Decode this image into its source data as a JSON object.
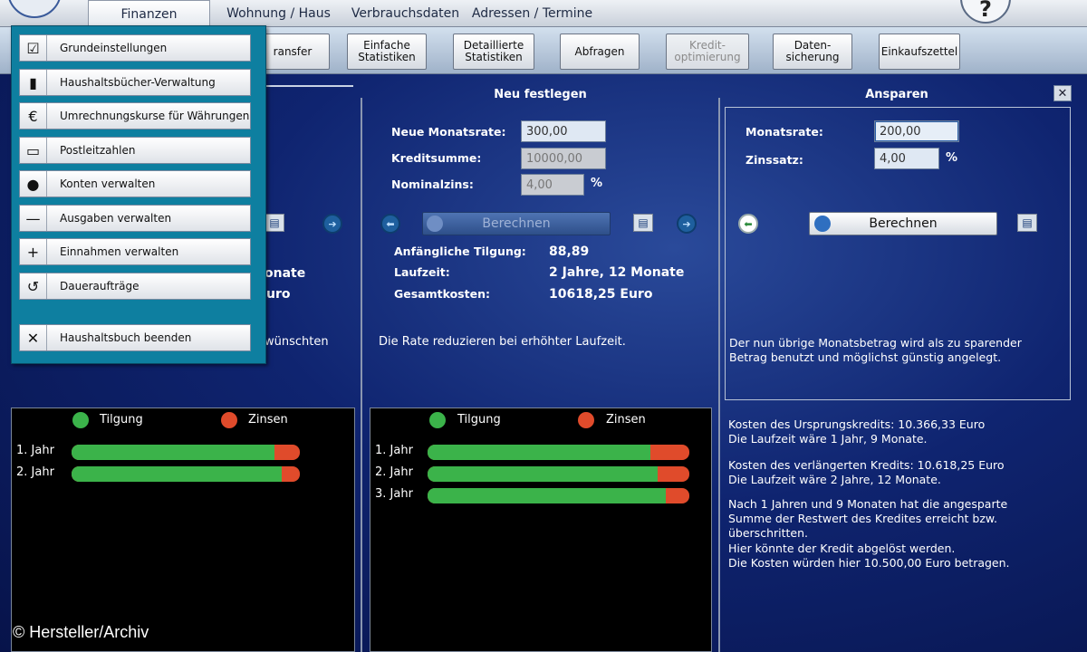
{
  "tabs": [
    "Finanzen",
    "Wohnung / Haus",
    "Verbrauchsdaten",
    "Adressen / Termine"
  ],
  "toolbar": {
    "transfer": "ransfer",
    "einfache": "Einfache\nStatistiken",
    "detaillierte": "Detaillierte\nStatistiken",
    "abfragen": "Abfragen",
    "kredit": "Kredit-\noptimierung",
    "daten": "Daten-\nsicherung",
    "einkauf": "Einkaufszettel"
  },
  "menu": [
    {
      "icon": "☑",
      "label": "Grundeinstellungen"
    },
    {
      "icon": "▮",
      "label": "Haushaltsbücher-Verwaltung"
    },
    {
      "icon": "€",
      "label": "Umrechnungskurse für Währungen"
    },
    {
      "icon": "▭",
      "label": "Postleitzahlen"
    },
    {
      "icon": "●",
      "label": "Konten verwalten"
    },
    {
      "icon": "—",
      "label": "Ausgaben verwalten"
    },
    {
      "icon": "+",
      "label": "Einnahmen verwalten"
    },
    {
      "icon": "↺",
      "label": "Daueraufträge"
    },
    {
      "icon": "✕",
      "label": "Haushaltsbuch beenden"
    }
  ],
  "left": {
    "monate": "onate",
    "euro": "uro",
    "wunsch": "wünschten",
    "legend_tilgung": "Tilgung",
    "legend_zinsen": "Zinsen",
    "rows": [
      {
        "label": "1. Jahr",
        "tilgung_pct": 89
      },
      {
        "label": "2. Jahr",
        "tilgung_pct": 92
      }
    ]
  },
  "middle": {
    "title": "Neu festlegen",
    "monatsrate_label": "Neue Monatsrate:",
    "monatsrate_value": "300,00",
    "kreditsumme_label": "Kreditsumme:",
    "kreditsumme_value": "10000,00",
    "nominalzins_label": "Nominalzins:",
    "nominalzins_value": "4,00",
    "pct": "%",
    "berechnen": "Berechnen",
    "tilgung_label": "Anfängliche Tilgung:",
    "tilgung_value": "88,89",
    "laufzeit_label": "Laufzeit:",
    "laufzeit_value": "2 Jahre, 12 Monate",
    "gesamt_label": "Gesamtkosten:",
    "gesamt_value": "10618,25 Euro",
    "note": "Die Rate reduzieren bei erhöhter Laufzeit.",
    "legend_tilgung": "Tilgung",
    "legend_zinsen": "Zinsen",
    "rows": [
      {
        "label": "1. Jahr",
        "tilgung_pct": 85
      },
      {
        "label": "2. Jahr",
        "tilgung_pct": 88
      },
      {
        "label": "3. Jahr",
        "tilgung_pct": 91
      }
    ]
  },
  "right": {
    "title": "Ansparen",
    "monatsrate_label": "Monatsrate:",
    "monatsrate_value": "200,00",
    "zinssatz_label": "Zinssatz:",
    "zinssatz_value": "4,00",
    "pct": "%",
    "berechnen": "Berechnen",
    "note1": "Der nun übrige Monatsbetrag wird als zu sparender",
    "note2": "Betrag benutzt und möglichst günstig angelegt.",
    "k1": "Kosten des Ursprungskredits: 10.366,33 Euro",
    "k2": "Die Laufzeit wäre 1 Jahr, 9 Monate.",
    "k3": "Kosten des verlängerten Kredits: 10.618,25 Euro",
    "k4": "Die Laufzeit wäre 2 Jahre, 12 Monate.",
    "k5": "Nach 1 Jahren und 9 Monaten hat die angesparte",
    "k6": "Summe der Restwert des Kredites erreicht bzw.",
    "k7": "überschritten.",
    "k8": "Hier könnte der Kredit abgelöst werden.",
    "k9": "Die Kosten würden hier 10.500,00 Euro betragen."
  },
  "copyright": "© Hersteller/Archiv",
  "colors": {
    "tilgung": "#3bb34a",
    "zinsen": "#e04b2b"
  }
}
